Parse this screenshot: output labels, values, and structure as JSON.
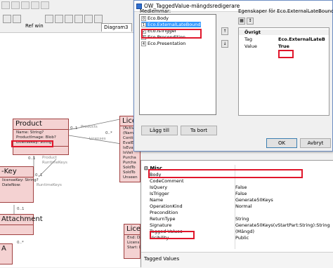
{
  "background": {
    "toolbar": {
      "ref_label": "Ref win",
      "diagram_tab": "Diagram3"
    },
    "classes": {
      "product": {
        "title": "Product",
        "attributes": [
          "Name: String?",
          "ProductImage: Blob?",
          "LicenseKey: String"
        ]
      },
      "license_partial": {
        "title": "Lice",
        "attributes": [
          "(Activ",
          "(Nam",
          "Contin",
          "EvalE",
          "IsEval",
          "IsVali",
          "Purcha",
          "Purcha",
          "SoldTo",
          "SoldTo",
          "Unseen"
        ]
      },
      "key_partial": {
        "title": "-Key",
        "attributes": [
          "licenseKey: String?",
          "DateNow:"
        ]
      },
      "attachment_partial": {
        "title": "Attachment"
      },
      "license_lower_partial": {
        "title": "Licen",
        "attributes": [
          "End: Da",
          "Licens",
          "Start: D"
        ]
      },
      "a_partial": {
        "title": "A"
      }
    },
    "associations": {
      "products_label": "Products",
      "licenses_label": "Licenses",
      "product_label": "Product",
      "runtimekeys_label": "RuntimeKeys",
      "runtimekeys_label2": "RuntimeKeys",
      "mult_1": "0..1",
      "mult_2": "0..*",
      "mult_3": "0..1",
      "mult_4": "0..1",
      "mult_5": "0..1",
      "mult_6": "0..*"
    }
  },
  "dialog": {
    "title": "OW_TaggedValue-mängdsredigerare",
    "members_label": "Medlemmar:",
    "members": [
      {
        "num": "0",
        "label": "Eco.Body"
      },
      {
        "num": "1",
        "label": "Eco.ExternalLateBound"
      },
      {
        "num": "2",
        "label": "Eco.IsTrigger"
      },
      {
        "num": "3",
        "label": "Eco.Precondition"
      },
      {
        "num": "4",
        "label": "Eco.Presentation"
      }
    ],
    "move_up": "↑",
    "move_down": "↓",
    "add_button": "Lägg till",
    "remove_button": "Ta bort",
    "properties_label": "Egenskaper för Eco.ExternalLateBound:",
    "properties": {
      "category": "Övrigt",
      "rows": [
        {
          "key": "Tag",
          "value": "Eco.ExternalLateB"
        },
        {
          "key": "Value",
          "value": "True"
        }
      ]
    },
    "ok_button": "OK",
    "cancel_button": "Avbryt"
  },
  "lower_grid": {
    "category": "Misc",
    "rows": [
      {
        "key": "Body",
        "value": ""
      },
      {
        "key": "CodeComment",
        "value": ""
      },
      {
        "key": "IsQuery",
        "value": "False"
      },
      {
        "key": "IsTrigger",
        "value": "False"
      },
      {
        "key": "Name",
        "value": "Generate50Keys"
      },
      {
        "key": "OperationKind",
        "value": "Normal"
      },
      {
        "key": "Precondition",
        "value": ""
      },
      {
        "key": "ReturnType",
        "value": "String"
      },
      {
        "key": "Signature",
        "value": "Generate50Keys(vStartPart:String):String"
      },
      {
        "key": "Tagged Values",
        "value": "(Mängd)"
      },
      {
        "key": "Visibility",
        "value": "Public"
      }
    ],
    "description_title": "Tagged Values"
  },
  "colors": {
    "uml_fill": "#f4d2d2",
    "uml_border": "#a04040",
    "highlight": "#e0162b",
    "selection": "#3399ff"
  }
}
